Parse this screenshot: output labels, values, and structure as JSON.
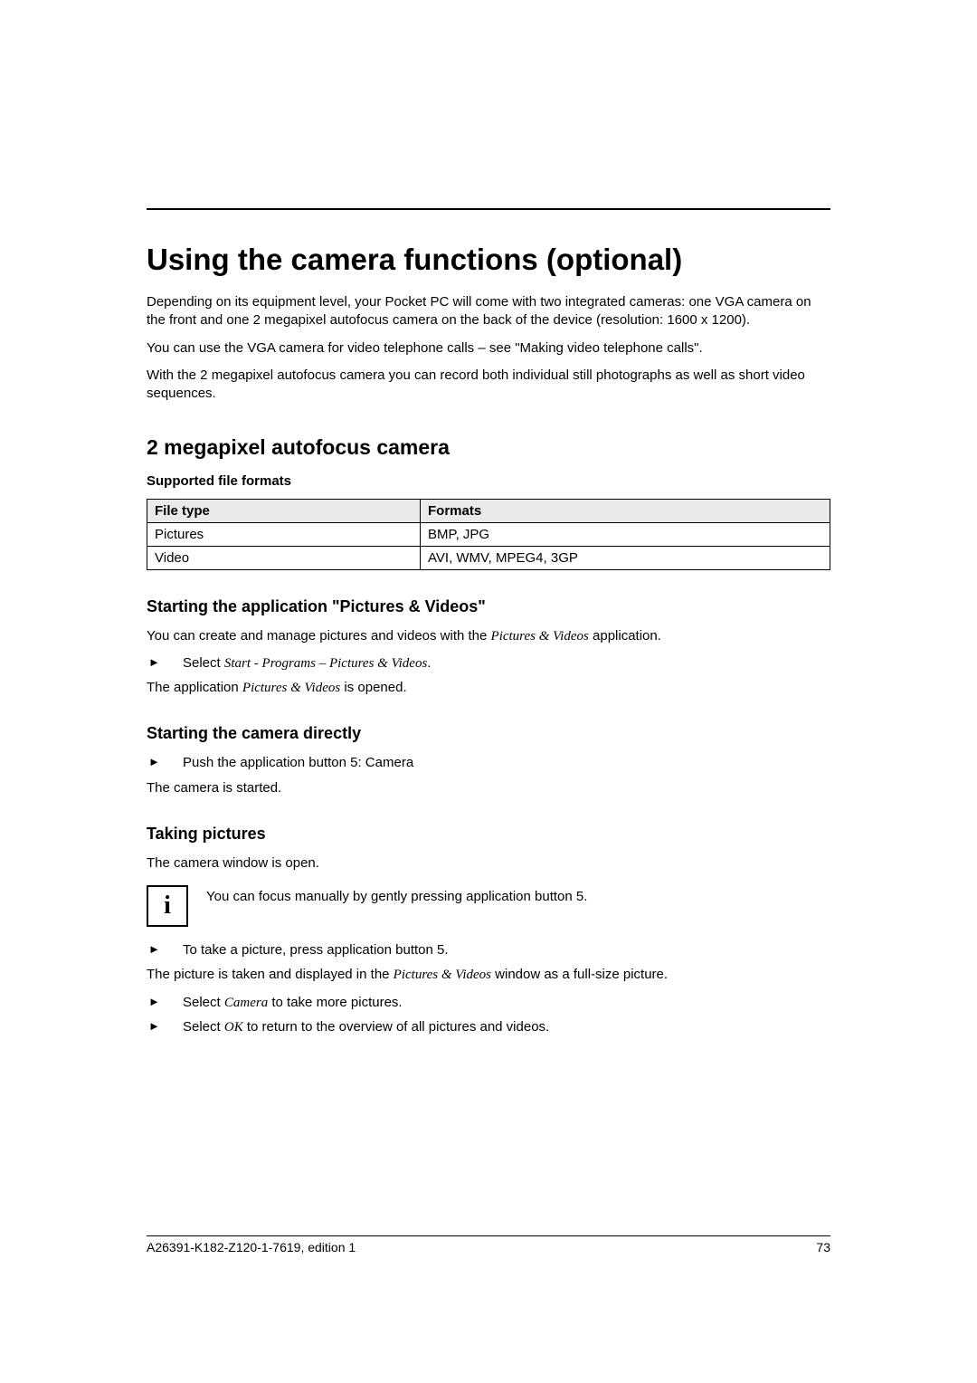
{
  "h1": "Using the camera functions (optional)",
  "intro1": "Depending on its equipment level, your Pocket PC will come with two integrated cameras: one VGA camera on the front and one 2 megapixel autofocus camera on the back of the device (resolution: 1600 x 1200).",
  "intro2": "You can use the VGA camera for video telephone calls – see \"Making video telephone calls\".",
  "intro3": "With the 2 megapixel autofocus camera you can record both individual still photographs as well as short video sequences.",
  "h2": "2 megapixel autofocus camera",
  "table_caption": "Supported file formats",
  "table": {
    "head": [
      "File type",
      "Formats"
    ],
    "rows": [
      [
        "Pictures",
        "BMP, JPG"
      ],
      [
        "Video",
        "AVI, WMV, MPEG4, 3GP"
      ]
    ]
  },
  "sec_app": {
    "h3": "Starting the application \"Pictures & Videos\"",
    "p1a": "You can create and manage pictures and videos with the ",
    "p1b": "Pictures & Videos",
    "p1c": " application.",
    "step_a": "Select ",
    "step_b": "Start - Programs – Pictures & Videos",
    "step_c": ".",
    "p2a": "The application ",
    "p2b": "Pictures & Videos",
    "p2c": " is opened."
  },
  "sec_direct": {
    "h3": "Starting the camera directly",
    "step": "Push the application button 5: Camera",
    "p": "The camera is started."
  },
  "sec_take": {
    "h3": "Taking pictures",
    "p_open": "The camera window is open.",
    "info": "You can focus manually by gently pressing application button 5.",
    "step1": "To take a picture, press application button 5.",
    "p_taken_a": "The picture is taken and displayed in the ",
    "p_taken_b": "Pictures & Videos",
    "p_taken_c": " window as a full-size picture.",
    "step2_a": "Select ",
    "step2_b": "Camera",
    "step2_c": " to take more pictures.",
    "step3_a": "Select ",
    "step3_b": "OK",
    "step3_c": " to return to the overview of all pictures and videos."
  },
  "footer": {
    "left": "A26391-K182-Z120-1-7619, edition 1",
    "right": "73"
  },
  "info_glyph": "i"
}
